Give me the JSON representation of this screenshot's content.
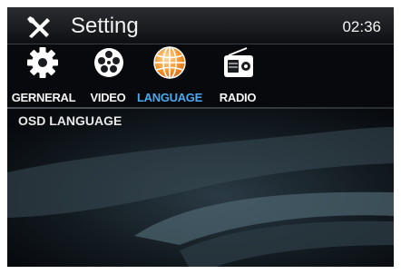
{
  "header": {
    "title": "Setting",
    "time": "02:36"
  },
  "tabs": [
    {
      "label": "GERNERAL",
      "icon": "gear-icon",
      "active": false
    },
    {
      "label": "VIDEO",
      "icon": "film-reel-icon",
      "active": false
    },
    {
      "label": "LANGUAGE",
      "icon": "globe-icon",
      "active": true
    },
    {
      "label": "RADIO",
      "icon": "radio-icon",
      "active": false
    }
  ],
  "options": [
    {
      "label": "OSD LANGUAGE"
    }
  ],
  "colors": {
    "active_tab": "#49aaf0",
    "active_icon": "#f08a2a",
    "background": "#07090c"
  }
}
